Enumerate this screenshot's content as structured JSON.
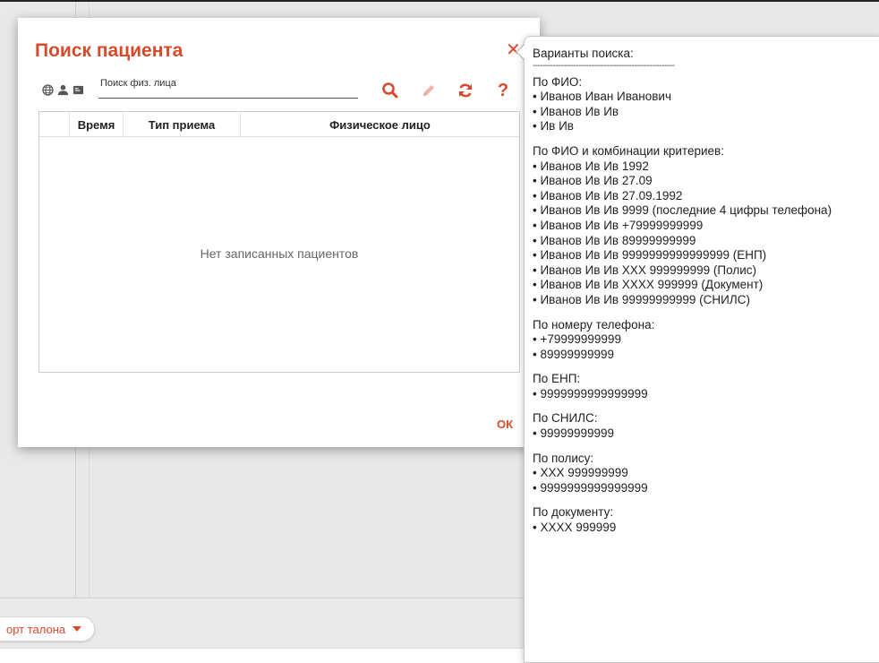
{
  "background": {
    "talon_button_label": "орт талона"
  },
  "dialog": {
    "title": "Поиск пациента",
    "search": {
      "label": "Поиск физ. лица",
      "value": ""
    },
    "scope_icons": [
      "globe-icon",
      "person-icon",
      "card-icon"
    ],
    "tools": [
      "search-icon",
      "pencil-icon",
      "refresh-icon",
      "help-icon"
    ],
    "table": {
      "columns": [
        "",
        "Время",
        "Тип приема",
        "Физическое лицо"
      ],
      "empty_text": "Нет записанных пациентов"
    },
    "ok_label": "ОК"
  },
  "hint": {
    "title": "Варианты поиска:",
    "separator": "--------------------------------------------------------",
    "sections": [
      {
        "heading": "По ФИО:",
        "items": [
          "• Иванов Иван Иванович",
          "• Иванов Ив Ив",
          "• Ив Ив"
        ]
      },
      {
        "heading": "По ФИО и комбинации  критериев:",
        "items": [
          "• Иванов Ив Ив 1992",
          "• Иванов Ив Ив 27.09",
          "• Иванов Ив Ив 27.09.1992",
          "• Иванов Ив Ив 9999 (последние 4 цифры телефона)",
          "• Иванов Ив Ив +79999999999",
          "• Иванов Ив Ив 89999999999",
          "• Иванов Ив Ив 9999999999999999 (ЕНП)",
          "• Иванов Ив Ив ХХХ 999999999 (Полис)",
          "• Иванов Ив Ив ХХХХ 999999 (Документ)",
          "• Иванов Ив Ив 99999999999 (СНИЛС)"
        ]
      },
      {
        "heading": "По номеру телефона:",
        "items": [
          "• +79999999999",
          "• 89999999999"
        ]
      },
      {
        "heading": "По ЕНП:",
        "items": [
          "• 9999999999999999"
        ]
      },
      {
        "heading": "По СНИЛС:",
        "items": [
          "• 99999999999"
        ]
      },
      {
        "heading": "По полису:",
        "items": [
          "• ХХХ 999999999",
          "• 9999999999999999"
        ]
      },
      {
        "heading": "По документу:",
        "items": [
          "• ХХХХ 999999"
        ]
      }
    ]
  },
  "colors": {
    "accent": "#d94a2c",
    "text": "#222222",
    "muted": "#666666"
  }
}
